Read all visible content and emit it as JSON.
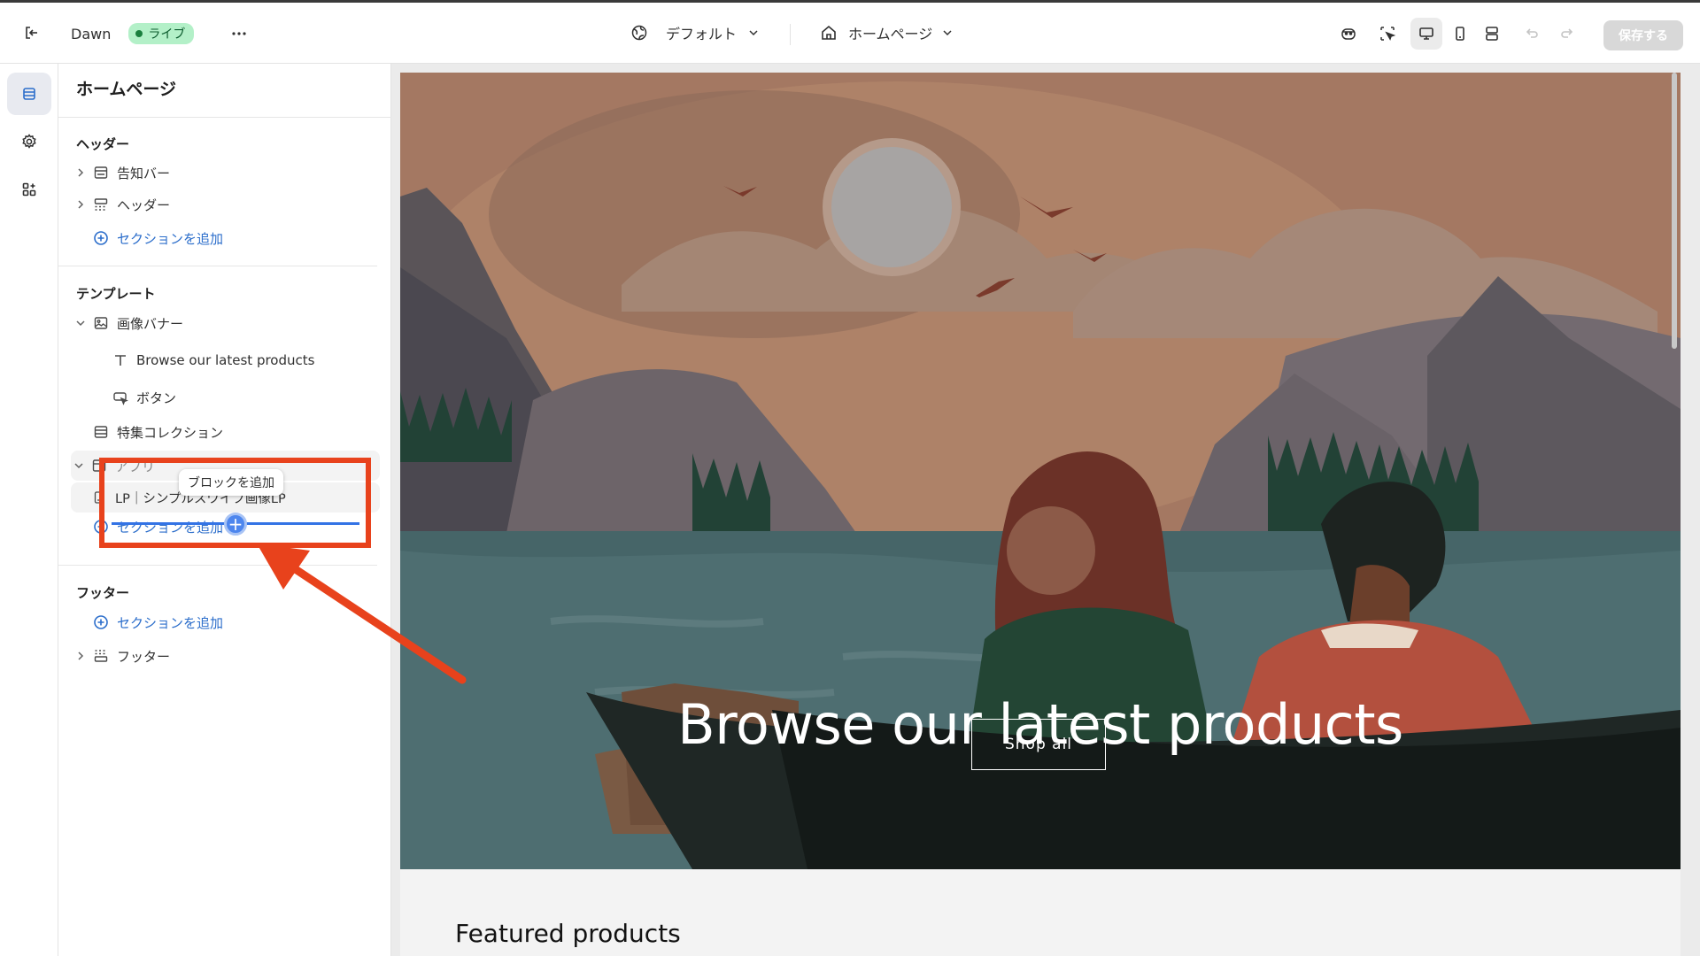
{
  "topbar": {
    "store_name": "Dawn",
    "live_badge": "ライブ",
    "theme_select": "デフォルト",
    "page_select": "ホームページ",
    "save_label": "保存する"
  },
  "sidebar": {
    "title": "ホームページ",
    "header_group": {
      "label": "ヘッダー",
      "items": [
        {
          "label": "告知バー",
          "icon": "announcement-bar-icon"
        },
        {
          "label": "ヘッダー",
          "icon": "header-layout-icon"
        }
      ],
      "add_section": "セクションを追加"
    },
    "template_group": {
      "label": "テンプレート",
      "image_banner": {
        "label": "画像バナー",
        "blocks": [
          {
            "label": "Browse our latest products",
            "icon": "text-icon"
          },
          {
            "label": "ボタン",
            "icon": "button-icon"
          }
        ]
      },
      "featured_collection": "特集コレクション",
      "apps": {
        "label": "アプリ",
        "blocks": [
          {
            "label": "LP｜シンプルスワイプ画像LP",
            "icon": "app-block-icon"
          }
        ]
      },
      "add_section": "セクションを追加"
    },
    "footer_group": {
      "label": "フッター",
      "add_section": "セクションを追加",
      "items": [
        {
          "label": "フッター",
          "icon": "footer-layout-icon"
        }
      ]
    },
    "tooltip": "ブロックを追加"
  },
  "preview": {
    "hero_title": "Browse our latest products",
    "hero_button": "Shop all",
    "featured_heading": "Featured products"
  },
  "colors": {
    "annotation_red": "#e8421c",
    "link_blue": "#2c6ecb",
    "live_green": "#b3f0c8"
  }
}
